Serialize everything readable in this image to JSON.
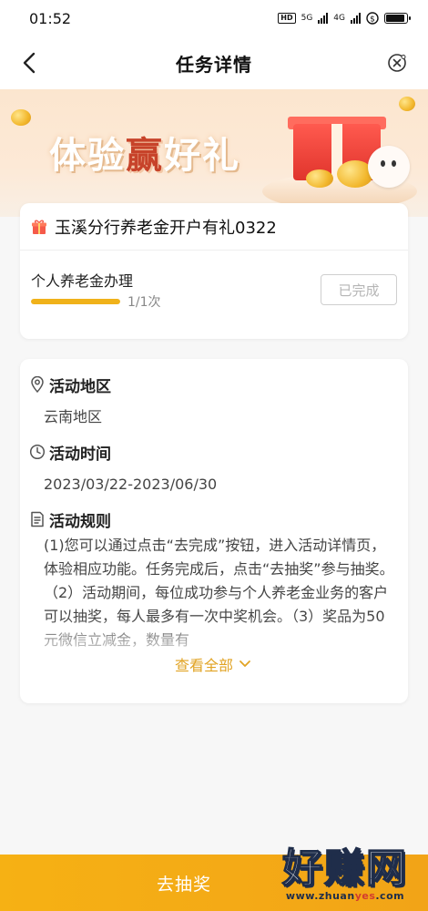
{
  "status_bar": {
    "time": "01:52",
    "network_badge": "HD",
    "signal_1_label": "5G",
    "signal_2_label": "4G",
    "battery_level": 0.9
  },
  "header": {
    "title": "任务详情",
    "back_icon": "chevron-left-icon",
    "close_icon": "close-circle-icon"
  },
  "banner": {
    "text_before": "体验",
    "text_highlight": "赢",
    "text_after": "好礼"
  },
  "task": {
    "title": "玉溪分行养老金开户有礼0322",
    "item_name": "个人养老金办理",
    "progress_fraction": 1.0,
    "progress_text": "1/1次",
    "status_button": "已完成"
  },
  "details": {
    "region_label": "活动地区",
    "region_value": "云南地区",
    "time_label": "活动时间",
    "time_value": "2023/03/22-2023/06/30",
    "rules_label": "活动规则",
    "rules_text": "(1)您可以通过点击“去完成”按钮，进入活动详情页，体验相应功能。任务完成后，点击“去抽奖”参与抽奖。（2）活动期间，每位成功参与个人养老金业务的客户可以抽奖，每人最多有一次中奖机会。（3）奖品为50元微信立减金，数量有",
    "view_all": "查看全部"
  },
  "bottom": {
    "action_label": "去抽奖"
  },
  "watermark": {
    "big": "好赚网",
    "small_prefix": "www.zhuan",
    "small_highlight": "yes",
    "small_suffix": ".com"
  },
  "colors": {
    "accent": "#f2a417",
    "progress": "#f0b21a",
    "link": "#e1a323",
    "banner_highlight": "#c7432a"
  }
}
